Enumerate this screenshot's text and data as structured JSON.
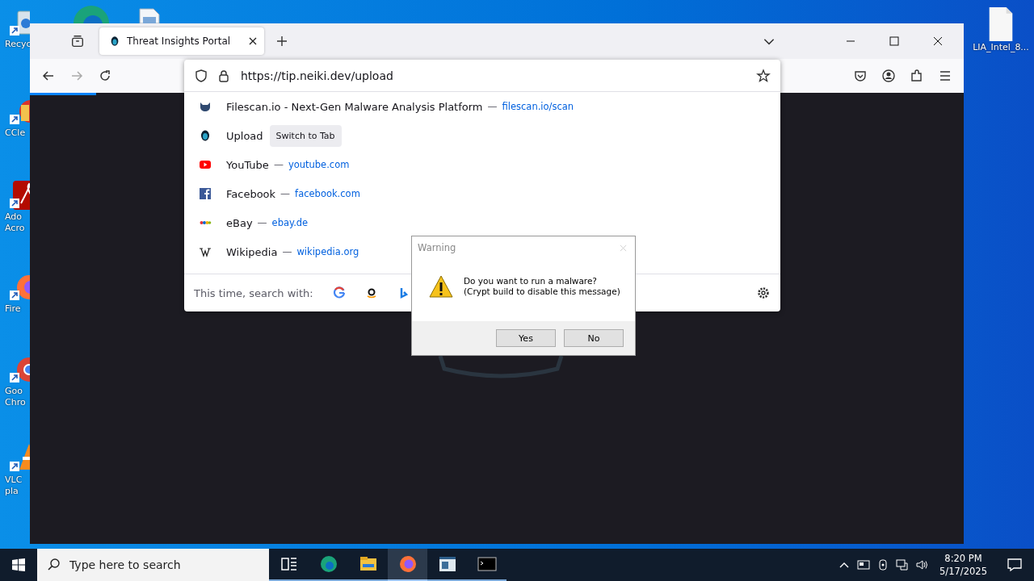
{
  "desktop": {
    "left_icons": [
      {
        "label_lines": [
          "Recyc"
        ]
      },
      {
        "label_lines": [
          "CCle"
        ]
      },
      {
        "label_lines": [
          "Ado",
          "Acro"
        ]
      },
      {
        "label_lines": [
          "Fire"
        ]
      },
      {
        "label_lines": [
          "Goo",
          "Chro"
        ]
      },
      {
        "label_lines": [
          "VLC",
          "pla"
        ]
      }
    ],
    "right_icons": [
      {
        "label": "LIA_Intel_8..."
      }
    ]
  },
  "browser": {
    "tabs": [
      {
        "title": "Threat Insights Portal",
        "selected": true
      }
    ],
    "url": "https://tip.neiki.dev/upload",
    "suggestions": [
      {
        "kind": "visit",
        "title": "Filescan.io - Next-Gen Malware Analysis Platform",
        "dash": "—",
        "url": "filescan.io/scan"
      },
      {
        "kind": "switch",
        "title": "Upload",
        "action": "Switch to Tab"
      },
      {
        "kind": "visit",
        "title": "YouTube",
        "dash": "—",
        "url": "youtube.com"
      },
      {
        "kind": "visit",
        "title": "Facebook",
        "dash": "—",
        "url": "facebook.com"
      },
      {
        "kind": "visit",
        "title": "eBay",
        "dash": "—",
        "url": "ebay.de"
      },
      {
        "kind": "visit",
        "title": "Wikipedia",
        "dash": "—",
        "url": "wikipedia.org"
      }
    ],
    "search_with": "This time, search with:"
  },
  "dialog": {
    "title": "Warning",
    "message": [
      "Do you want to run a malware?",
      "(Crypt build to disable this message)"
    ],
    "buttons": [
      "Yes",
      "No"
    ]
  },
  "taskbar": {
    "search_placeholder": "Type here to search",
    "apps": [
      {
        "selected": false
      },
      {
        "selected": false
      },
      {
        "selected": false
      },
      {
        "selected": true
      },
      {
        "selected": false
      },
      {
        "selected": false
      }
    ],
    "time": "8:20 PM",
    "date": "5/17/2025"
  }
}
